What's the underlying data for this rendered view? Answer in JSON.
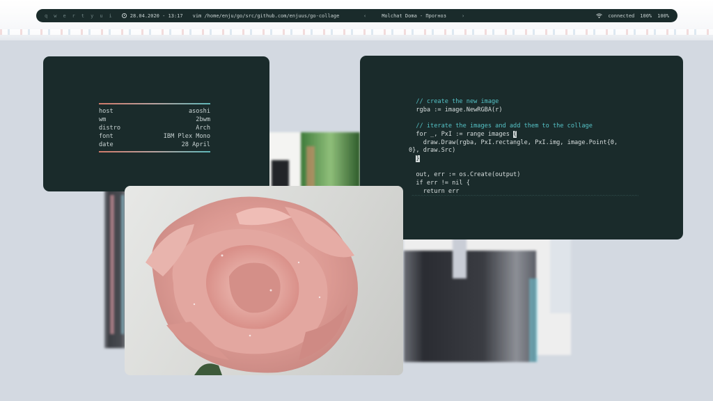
{
  "statusbar": {
    "workspaces": [
      "q",
      "w",
      "e",
      "r",
      "t",
      "y",
      "u",
      "i"
    ],
    "datetime": "28.04.2020 - 13:17",
    "window_title": "vim /home/enju/go/src/github.com/enjuus/go-collage",
    "media": {
      "prev": "‹",
      "track": "Molchat Doma - Прогноз",
      "next": "›"
    },
    "network": "connected",
    "volume": "100%",
    "battery": "100%"
  },
  "fetch": {
    "rows": [
      {
        "key": "host",
        "value": "asoshi"
      },
      {
        "key": "wm",
        "value": "2bwm"
      },
      {
        "key": "distro",
        "value": "Arch"
      },
      {
        "key": "font",
        "value": "IBM Plex Mono"
      },
      {
        "key": "date",
        "value": "28 April"
      }
    ]
  },
  "editor": {
    "lines": {
      "l1": "  // create the new image",
      "l2": "  rgba := image.NewRGBA(r)",
      "l3": "  // iterate the images and add them to the collage",
      "l4a": "  for _, PxI := range images ",
      "l4b": "{",
      "l5": "    draw.Draw(rgba, PxI.rectangle, PxI.img, image.Point{0,",
      "l6": "0}, draw.Src)",
      "l7": "}",
      "l8": "  out, err := os.Create(output)",
      "l9": "  if err != nil {",
      "l10": "    return err"
    }
  },
  "colors": {
    "terminal_bg": "#1a2b2b",
    "text": "#d8dfdf",
    "comment": "#55c3c7",
    "accent_warm": "#d07a6a",
    "accent_cool": "#5fb7b9"
  },
  "icons": [
    "clock-icon",
    "wifi-icon"
  ]
}
